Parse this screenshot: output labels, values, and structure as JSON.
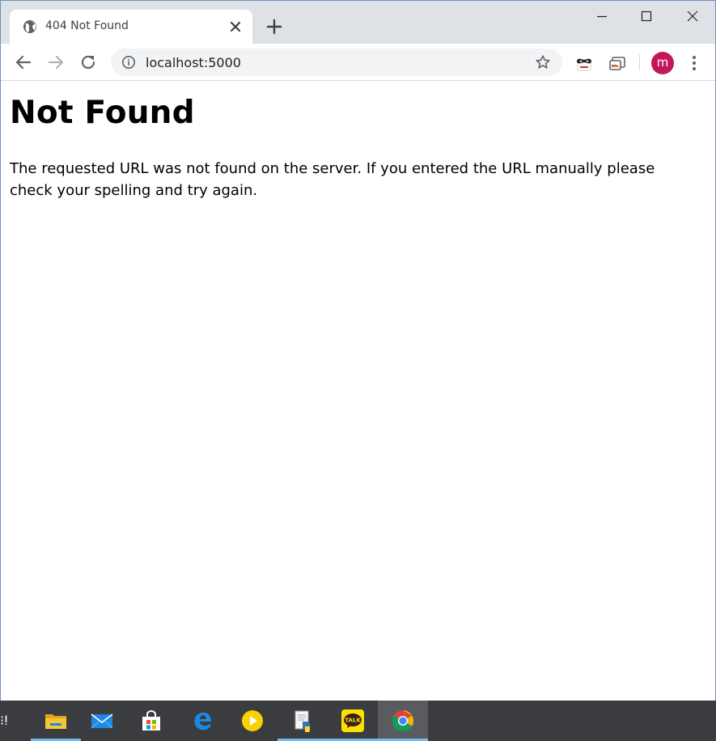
{
  "browser": {
    "tab": {
      "title": "404 Not Found",
      "favicon_icon": "globe-icon"
    },
    "omnibox": {
      "url": "localhost:5000",
      "security_icon": "info-icon"
    },
    "profile": {
      "initial": "m",
      "color": "#c2185b"
    },
    "icons": {
      "new_tab": "plus-icon",
      "back": "arrow-left-icon",
      "forward": "arrow-right-icon",
      "reload": "reload-icon",
      "bookmark": "star-icon",
      "extension_1": "mask-extension-icon",
      "extension_2": "cast-extension-icon",
      "menu": "kebab-menu-icon"
    }
  },
  "page": {
    "heading": "Not Found",
    "message": "The requested URL was not found on the server. If you entered the URL manually please check your spelling and try again."
  },
  "taskbar": {
    "edge_glyph": "⁝ⵑ",
    "apps": [
      {
        "icon": "file-explorer-icon",
        "running": true
      },
      {
        "icon": "mail-icon",
        "running": false
      },
      {
        "icon": "store-icon",
        "running": false
      },
      {
        "icon": "edge-icon",
        "running": false
      },
      {
        "icon": "media-player-icon",
        "running": false
      },
      {
        "icon": "python-editor-icon",
        "running": true
      },
      {
        "icon": "kakaotalk-icon",
        "running": true,
        "label": "TALK"
      },
      {
        "icon": "chrome-icon",
        "running": true,
        "active": true
      }
    ]
  },
  "colors": {
    "tabstrip": "#dee1e6",
    "omnibox": "#f1f3f4",
    "taskbar": "#3b3c40",
    "taskbar_indicator": "#76b9ed"
  }
}
